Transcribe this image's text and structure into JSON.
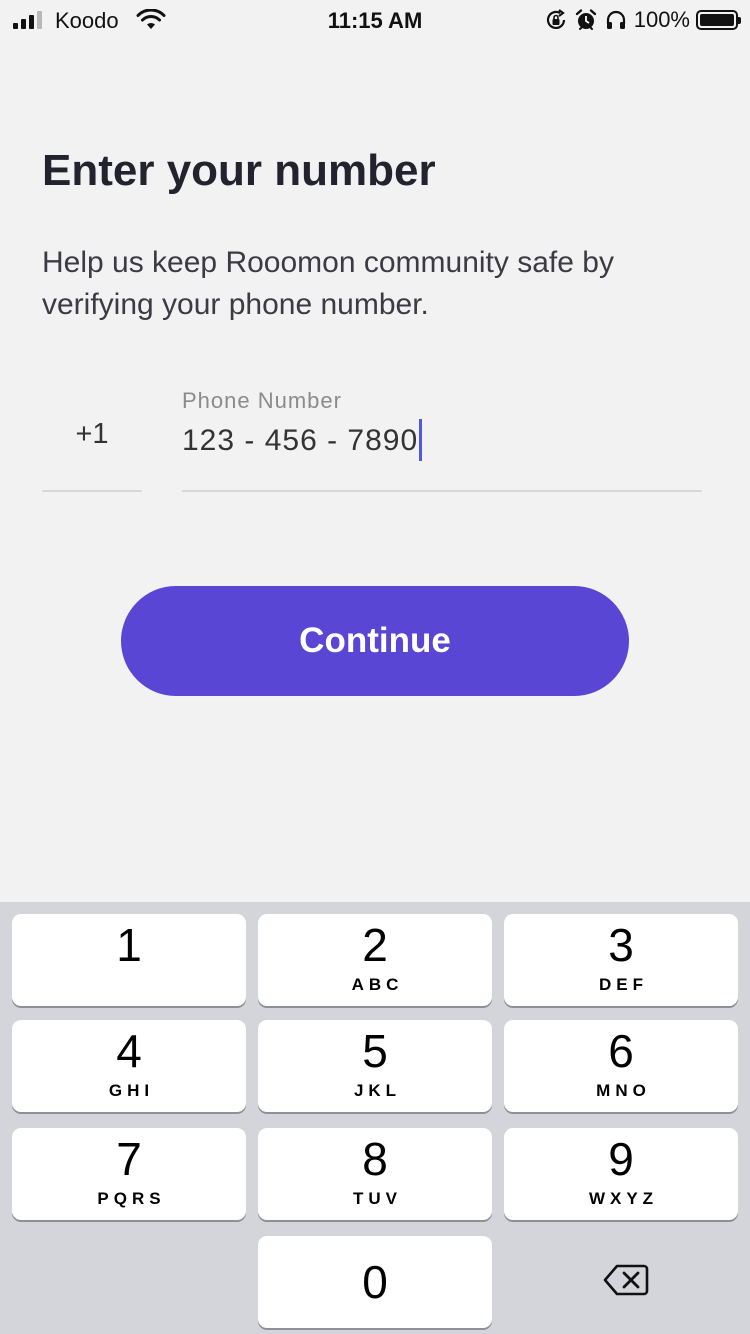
{
  "status_bar": {
    "carrier": "Koodo",
    "time": "11:15 AM",
    "battery": "100%",
    "signal_bars": 3,
    "signal_bars_total": 4,
    "icons": [
      "signal-icon",
      "wifi-icon",
      "orientation-lock-icon",
      "alarm-icon",
      "headphones-icon",
      "battery-icon"
    ]
  },
  "page": {
    "title": "Enter your number",
    "subtitle": "Help us keep Rooomon community safe by verifying your phone number."
  },
  "phone_form": {
    "country_code": "+1",
    "label": "Phone Number",
    "value": "123 - 456 - 7890"
  },
  "continue_label": "Continue",
  "colors": {
    "accent": "#5a46d4",
    "cursor": "#4f5ad8",
    "background": "#f2f2f2",
    "keypad_background": "#d3d5db"
  },
  "keypad": {
    "keys": [
      {
        "num": "1",
        "letters": ""
      },
      {
        "num": "2",
        "letters": "ABC"
      },
      {
        "num": "3",
        "letters": "DEF"
      },
      {
        "num": "4",
        "letters": "GHI"
      },
      {
        "num": "5",
        "letters": "JKL"
      },
      {
        "num": "6",
        "letters": "MNO"
      },
      {
        "num": "7",
        "letters": "PQRS"
      },
      {
        "num": "8",
        "letters": "TUV"
      },
      {
        "num": "9",
        "letters": "WXYZ"
      },
      {
        "num": "0",
        "letters": ""
      }
    ],
    "delete_icon": "backspace-icon"
  }
}
